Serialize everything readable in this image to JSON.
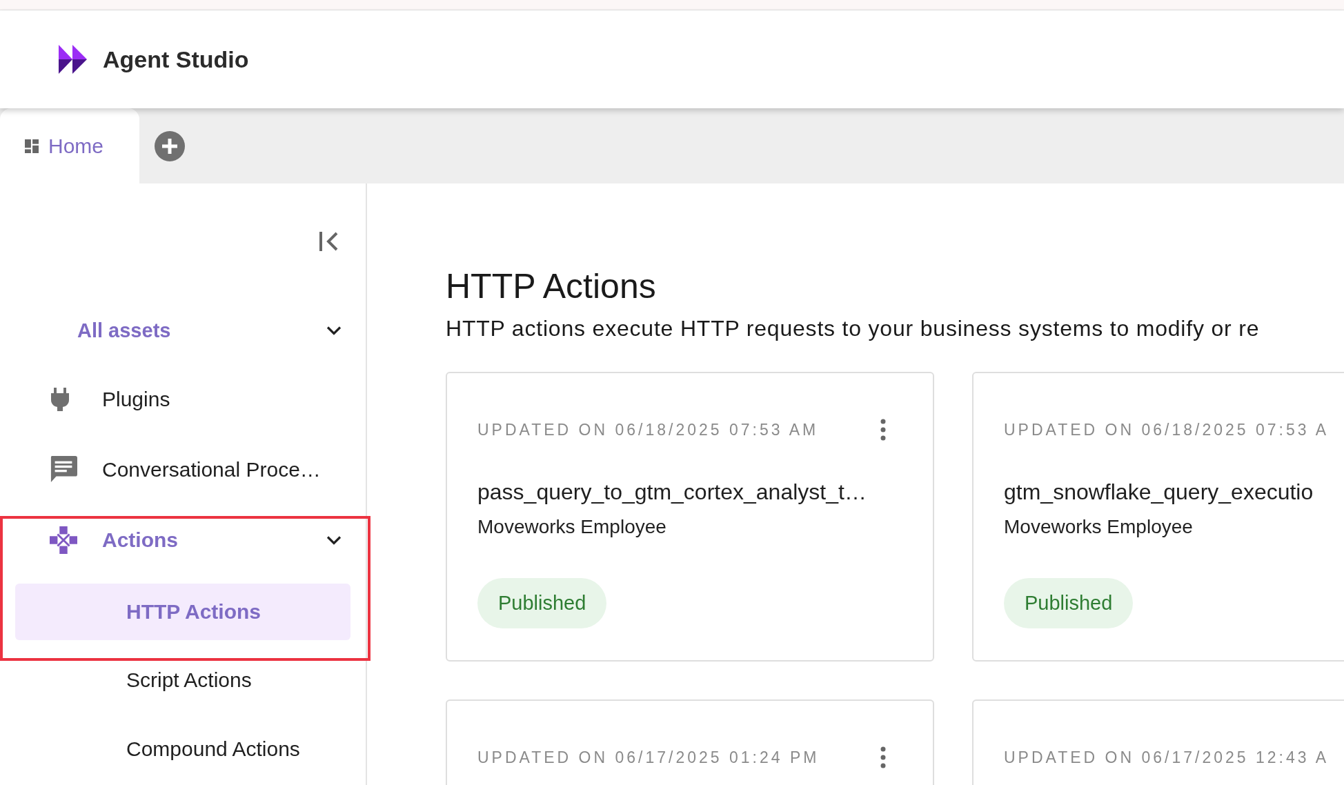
{
  "app": {
    "title": "Agent Studio"
  },
  "tabs": [
    {
      "label": "Home",
      "selected": true
    }
  ],
  "sidebar": {
    "section": {
      "label": "All assets",
      "expanded": true
    },
    "items": [
      {
        "label": "Plugins",
        "selected": false,
        "highlighted": false
      },
      {
        "label": "Conversational Proce…",
        "selected": false,
        "highlighted": false
      },
      {
        "label": "Actions",
        "selected": true,
        "expanded": true,
        "highlighted": true,
        "children": [
          {
            "label": "HTTP Actions",
            "selected": true
          },
          {
            "label": "Script Actions",
            "selected": false
          },
          {
            "label": "Compound Actions",
            "selected": false
          }
        ]
      }
    ]
  },
  "page": {
    "title": "HTTP Actions",
    "description": "HTTP actions execute HTTP requests to your business systems to modify or re"
  },
  "cards": [
    {
      "updated": "UPDATED ON 06/18/2025 07:53 AM",
      "name": "pass_query_to_gtm_cortex_analyst_t…",
      "owner": "Moveworks Employee",
      "status": "Published"
    },
    {
      "updated": "UPDATED ON 06/18/2025 07:53 A",
      "name": "gtm_snowflake_query_executio",
      "owner": "Moveworks Employee",
      "status": "Published"
    },
    {
      "updated": "UPDATED ON 06/17/2025 01:24 PM"
    },
    {
      "updated": "UPDATED ON 06/17/2025 12:43 A"
    }
  ]
}
